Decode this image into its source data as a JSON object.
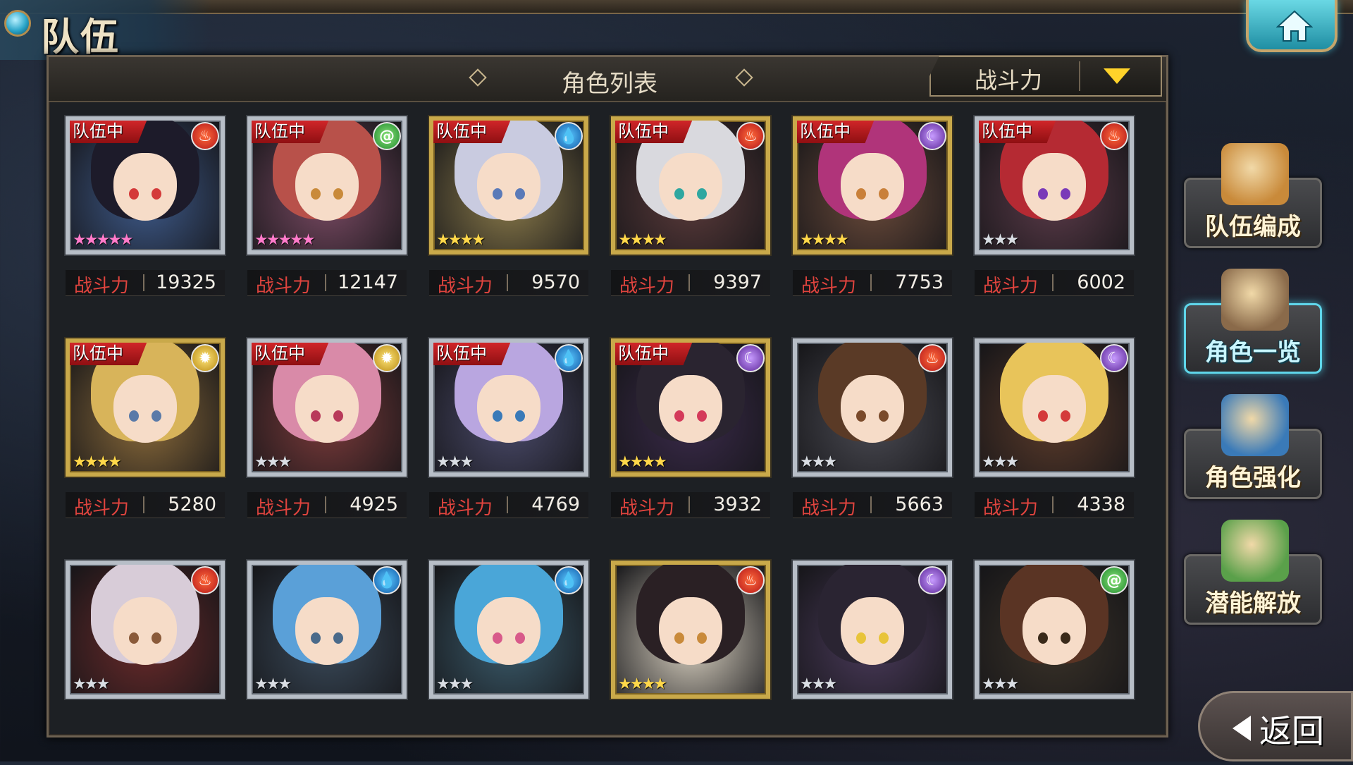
{
  "screen_title": "队伍",
  "header": {
    "title": "角色列表",
    "sort_label": "战斗力"
  },
  "power_label": "战斗力",
  "team_tag": "队伍中",
  "characters": [
    {
      "power": "19325",
      "in_team": true,
      "element": "fire-icon",
      "rarity": 5,
      "frame": "silver",
      "hair": "#1d1b2a",
      "eye": "#d43a3a",
      "bg": "#3e5a8a"
    },
    {
      "power": "12147",
      "in_team": true,
      "element": "wind-icon",
      "rarity": 5,
      "frame": "silver",
      "hair": "#b8514a",
      "eye": "#c98a3a",
      "bg": "#7a4a63"
    },
    {
      "power": "9570",
      "in_team": true,
      "element": "water-icon",
      "rarity": 4,
      "frame": "gold",
      "hair": "#c9cbe0",
      "eye": "#5a7ab8",
      "bg": "#8a7a4a"
    },
    {
      "power": "9397",
      "in_team": true,
      "element": "fire-icon",
      "rarity": 4,
      "frame": "gold",
      "hair": "#d9d9de",
      "eye": "#2fa7a0",
      "bg": "#5a3a3a"
    },
    {
      "power": "7753",
      "in_team": true,
      "element": "dark-icon",
      "rarity": 4,
      "frame": "gold",
      "hair": "#b0347a",
      "eye": "#c9803a",
      "bg": "#6a4a3a"
    },
    {
      "power": "6002",
      "in_team": true,
      "element": "fire-icon",
      "rarity": 3,
      "frame": "silver",
      "hair": "#b52a33",
      "eye": "#7a3ab8",
      "bg": "#5a3a48"
    },
    {
      "power": "5280",
      "in_team": true,
      "element": "light-icon",
      "rarity": 4,
      "frame": "gold",
      "hair": "#d8b45a",
      "eye": "#5a7aa8",
      "bg": "#8a6a3a"
    },
    {
      "power": "4925",
      "in_team": true,
      "element": "light-icon",
      "rarity": 3,
      "frame": "silver",
      "hair": "#d98aa8",
      "eye": "#b83a5a",
      "bg": "#7a3a3a"
    },
    {
      "power": "4769",
      "in_team": true,
      "element": "water-icon",
      "rarity": 3,
      "frame": "silver",
      "hair": "#b9a6e0",
      "eye": "#3a7ab8",
      "bg": "#4a4a6a"
    },
    {
      "power": "3932",
      "in_team": true,
      "element": "dark-icon",
      "rarity": 4,
      "frame": "gold",
      "hair": "#2a2430",
      "eye": "#d43a5a",
      "bg": "#3a2a4a"
    },
    {
      "power": "5663",
      "in_team": false,
      "element": "fire-icon",
      "rarity": 3,
      "frame": "silver",
      "hair": "#5a3a26",
      "eye": "#7a4a2a",
      "bg": "#4a4a52"
    },
    {
      "power": "4338",
      "in_team": false,
      "element": "dark-icon",
      "rarity": 3,
      "frame": "silver",
      "hair": "#e8c45a",
      "eye": "#d43a3a",
      "bg": "#5a3a2a"
    },
    {
      "power": "",
      "in_team": false,
      "element": "fire-icon",
      "rarity": 3,
      "frame": "silver",
      "hair": "#d8ccd8",
      "eye": "#8a5a3a",
      "bg": "#6a2a2a"
    },
    {
      "power": "",
      "in_team": false,
      "element": "water-icon",
      "rarity": 3,
      "frame": "silver",
      "hair": "#5aa0d8",
      "eye": "#4a6a8a",
      "bg": "#3a4a5a"
    },
    {
      "power": "",
      "in_team": false,
      "element": "water-icon",
      "rarity": 3,
      "frame": "silver",
      "hair": "#4aa6d8",
      "eye": "#d85a8a",
      "bg": "#3a5a6a"
    },
    {
      "power": "",
      "in_team": false,
      "element": "fire-icon",
      "rarity": 4,
      "frame": "gold",
      "hair": "#2a2024",
      "eye": "#c98a3a",
      "bg": "#d8d0c0"
    },
    {
      "power": "",
      "in_team": false,
      "element": "dark-icon",
      "rarity": 3,
      "frame": "silver",
      "hair": "#2a2432",
      "eye": "#e8c43a",
      "bg": "#4a3a5a"
    },
    {
      "power": "",
      "in_team": false,
      "element": "wind-icon",
      "rarity": 3,
      "frame": "silver",
      "hair": "#5a3424",
      "eye": "#3a2a1a",
      "bg": "#3a3228"
    }
  ],
  "side_menu": [
    {
      "label": "队伍编成",
      "active": false,
      "art": "#c98a3a"
    },
    {
      "label": "角色一览",
      "active": true,
      "art": "#8a6a4a"
    },
    {
      "label": "角色强化",
      "active": false,
      "art": "#3a7ab8"
    },
    {
      "label": "潜能解放",
      "active": false,
      "art": "#5aa04a"
    }
  ],
  "back_label": "返回",
  "colors": {
    "accent_cyan": "#5fd6ea",
    "power_label_red": "#e0443e",
    "team_tag_red": "#d4272a",
    "sort_arrow_yellow": "#ffd32a"
  }
}
